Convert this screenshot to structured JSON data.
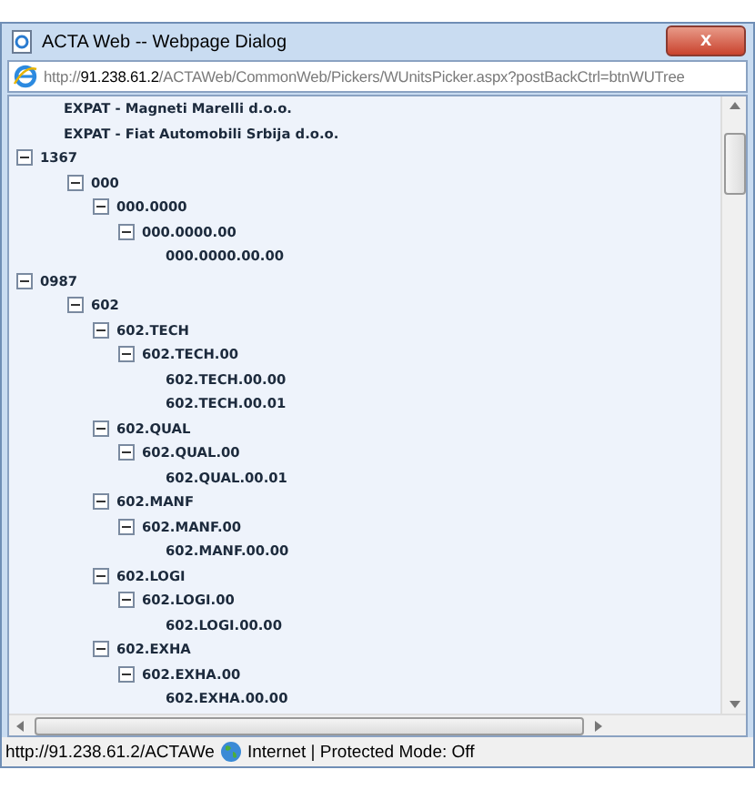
{
  "window": {
    "title": "ACTA Web -- Webpage Dialog",
    "close": "x"
  },
  "address_bar": {
    "scheme": "http://",
    "host": "91.238.61.2",
    "path": "/ACTAWeb/CommonWeb/Pickers/WUnitsPicker.aspx?postBackCtrl=btnWUTree"
  },
  "tree": [
    {
      "label": "EXPAT - Magneti Marelli d.o.o."
    },
    {
      "label": "EXPAT - Fiat Automobili Srbija d.o.o."
    },
    {
      "label": "1367",
      "expanded": true,
      "children": [
        {
          "label": "000",
          "expanded": true,
          "children": [
            {
              "label": "000.0000",
              "expanded": true,
              "children": [
                {
                  "label": "000.0000.00",
                  "expanded": true,
                  "children": [
                    {
                      "label": "000.0000.00.00"
                    }
                  ]
                }
              ]
            }
          ]
        }
      ]
    },
    {
      "label": "0987",
      "expanded": true,
      "children": [
        {
          "label": "602",
          "expanded": true,
          "children": [
            {
              "label": "602.TECH",
              "expanded": true,
              "children": [
                {
                  "label": "602.TECH.00",
                  "expanded": true,
                  "children": [
                    {
                      "label": "602.TECH.00.00"
                    },
                    {
                      "label": "602.TECH.00.01"
                    }
                  ]
                }
              ]
            },
            {
              "label": "602.QUAL",
              "expanded": true,
              "children": [
                {
                  "label": "602.QUAL.00",
                  "expanded": true,
                  "children": [
                    {
                      "label": "602.QUAL.00.01"
                    }
                  ]
                }
              ]
            },
            {
              "label": "602.MANF",
              "expanded": true,
              "children": [
                {
                  "label": "602.MANF.00",
                  "expanded": true,
                  "children": [
                    {
                      "label": "602.MANF.00.00"
                    }
                  ]
                }
              ]
            },
            {
              "label": "602.LOGI",
              "expanded": true,
              "children": [
                {
                  "label": "602.LOGI.00",
                  "expanded": true,
                  "children": [
                    {
                      "label": "602.LOGI.00.00"
                    }
                  ]
                }
              ]
            },
            {
              "label": "602.EXHA",
              "expanded": true,
              "children": [
                {
                  "label": "602.EXHA.00",
                  "expanded": true,
                  "children": [
                    {
                      "label": "602.EXHA.00.00"
                    }
                  ]
                }
              ]
            }
          ]
        }
      ]
    }
  ],
  "status_bar": {
    "url": "http://91.238.61.2/ACTAWe",
    "zone": "Internet | Protected Mode: Off"
  }
}
